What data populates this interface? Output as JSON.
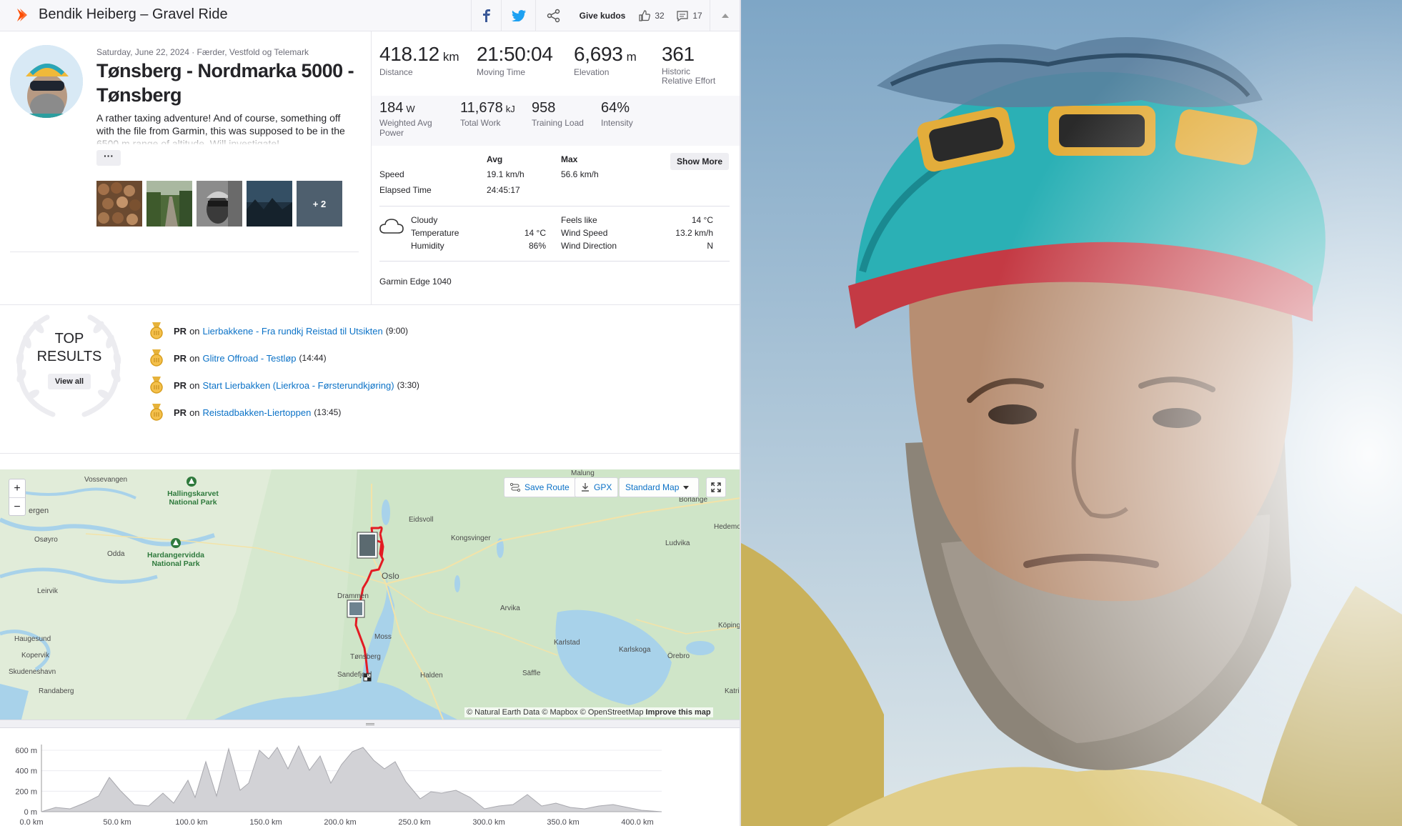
{
  "header": {
    "title": "Bendik Heiberg – Gravel Ride",
    "kudos_label": "Give kudos",
    "kudos_count": "32",
    "comment_count": "17"
  },
  "activity": {
    "date_location": "Saturday, June 22, 2024 · Færder, Vestfold og Telemark",
    "name": "Tønsberg - Nordmarka 5000 - Tønsberg",
    "description": "A rather taxing adventure! And of course, something off with the file from Garmin, this was supposed to be in the 6500 m range of altitude. Will investigate!",
    "more_label": "···",
    "photos_more": "+ 2"
  },
  "stats": {
    "distance": {
      "value": "418.12",
      "unit": "km",
      "label": "Distance"
    },
    "moving_time": {
      "value": "21:50:04",
      "label": "Moving Time"
    },
    "elevation": {
      "value": "6,693",
      "unit": "m",
      "label": "Elevation"
    },
    "relative_effort": {
      "value": "361",
      "label_line1": "Historic",
      "label_line2": "Relative Effort"
    },
    "power": {
      "value": "184",
      "unit": "W",
      "label_line1": "Weighted Avg",
      "label_line2": "Power"
    },
    "total_work": {
      "value": "11,678",
      "unit": "kJ",
      "label": "Total Work"
    },
    "training_load": {
      "value": "958",
      "label": "Training Load"
    },
    "intensity": {
      "value": "64%",
      "label": "Intensity"
    }
  },
  "details": {
    "avg_header": "Avg",
    "max_header": "Max",
    "show_more": "Show More",
    "speed_label": "Speed",
    "speed_avg": "19.1 km/h",
    "speed_max": "56.6 km/h",
    "elapsed_label": "Elapsed Time",
    "elapsed_value": "24:45:17"
  },
  "weather": {
    "condition": "Cloudy",
    "temperature_label": "Temperature",
    "temperature": "14 °C",
    "humidity_label": "Humidity",
    "humidity": "86%",
    "feels_like_label": "Feels like",
    "feels_like": "14 °C",
    "wind_speed_label": "Wind Speed",
    "wind_speed": "13.2 km/h",
    "wind_dir_label": "Wind Direction",
    "wind_dir": "N"
  },
  "device": "Garmin Edge 1040",
  "top_results": {
    "title_line1": "TOP",
    "title_line2": "RESULTS",
    "view_all": "View all",
    "items": [
      {
        "tag": "PR",
        "on": "on",
        "segment": "Lierbakkene - Fra rundkj Reistad til Utsikten",
        "time": "(9:00)"
      },
      {
        "tag": "PR",
        "on": "on",
        "segment": "Glitre Offroad - Testløp",
        "time": "(14:44)"
      },
      {
        "tag": "PR",
        "on": "on",
        "segment": "Start Lierbakken (Lierkroa - Førsterundkjøring)",
        "time": "(3:30)"
      },
      {
        "tag": "PR",
        "on": "on",
        "segment": "Reistadbakken-Liertoppen",
        "time": "(13:45)"
      }
    ]
  },
  "map": {
    "save_route": "Save Route",
    "gpx": "GPX",
    "map_type": "Standard Map",
    "zoom_in": "+",
    "zoom_out": "−",
    "attribution": "© Natural Earth Data © Mapbox © OpenStreetMap",
    "improve": "Improve this map",
    "labels": {
      "vossevangen": "Vossevangen",
      "bergen": "ergen",
      "osoyro": "Osøyro",
      "odda": "Odda",
      "leirvik": "Leirvik",
      "haugesund": "Haugesund",
      "kopervik": "Kopervik",
      "skudeneshavn": "Skudeneshavn",
      "randaberg": "Randaberg",
      "hallingskarvet": "Hallingskarvet",
      "hallingskarvet_np": "National Park",
      "hardangervidda": "Hardangervidda",
      "hardangervidda_np": "National Park",
      "eidsvoll": "Eidsvoll",
      "kongsvinger": "Kongsvinger",
      "oslo": "Oslo",
      "drammen": "Drammen",
      "moss": "Moss",
      "tonsberg": "Tønsberg",
      "sandefjord": "Sandefjord",
      "halden": "Halden",
      "arvika": "Arvika",
      "karlstad": "Karlstad",
      "saffle": "Säffle",
      "karlskoga": "Karlskoga",
      "orebro": "Örebro",
      "ludvika": "Ludvika",
      "malung": "Malung",
      "borlange": "Borlänge",
      "hedemora": "Hedemo",
      "koping": "Köping",
      "katrineholm": "Katri"
    }
  },
  "elevation_chart": {
    "y_ticks": [
      "0 m",
      "200 m",
      "400 m",
      "600 m"
    ],
    "x_ticks": [
      "0.0 km",
      "50.0 km",
      "100.0 km",
      "150.0 km",
      "200.0 km",
      "250.0 km",
      "300.0 km",
      "350.0 km",
      "400.0 km"
    ]
  },
  "colors": {
    "brand": "#fc4c02",
    "relative_effort": "#cc2222",
    "link": "#0b72c7",
    "route": "#e31b23"
  }
}
